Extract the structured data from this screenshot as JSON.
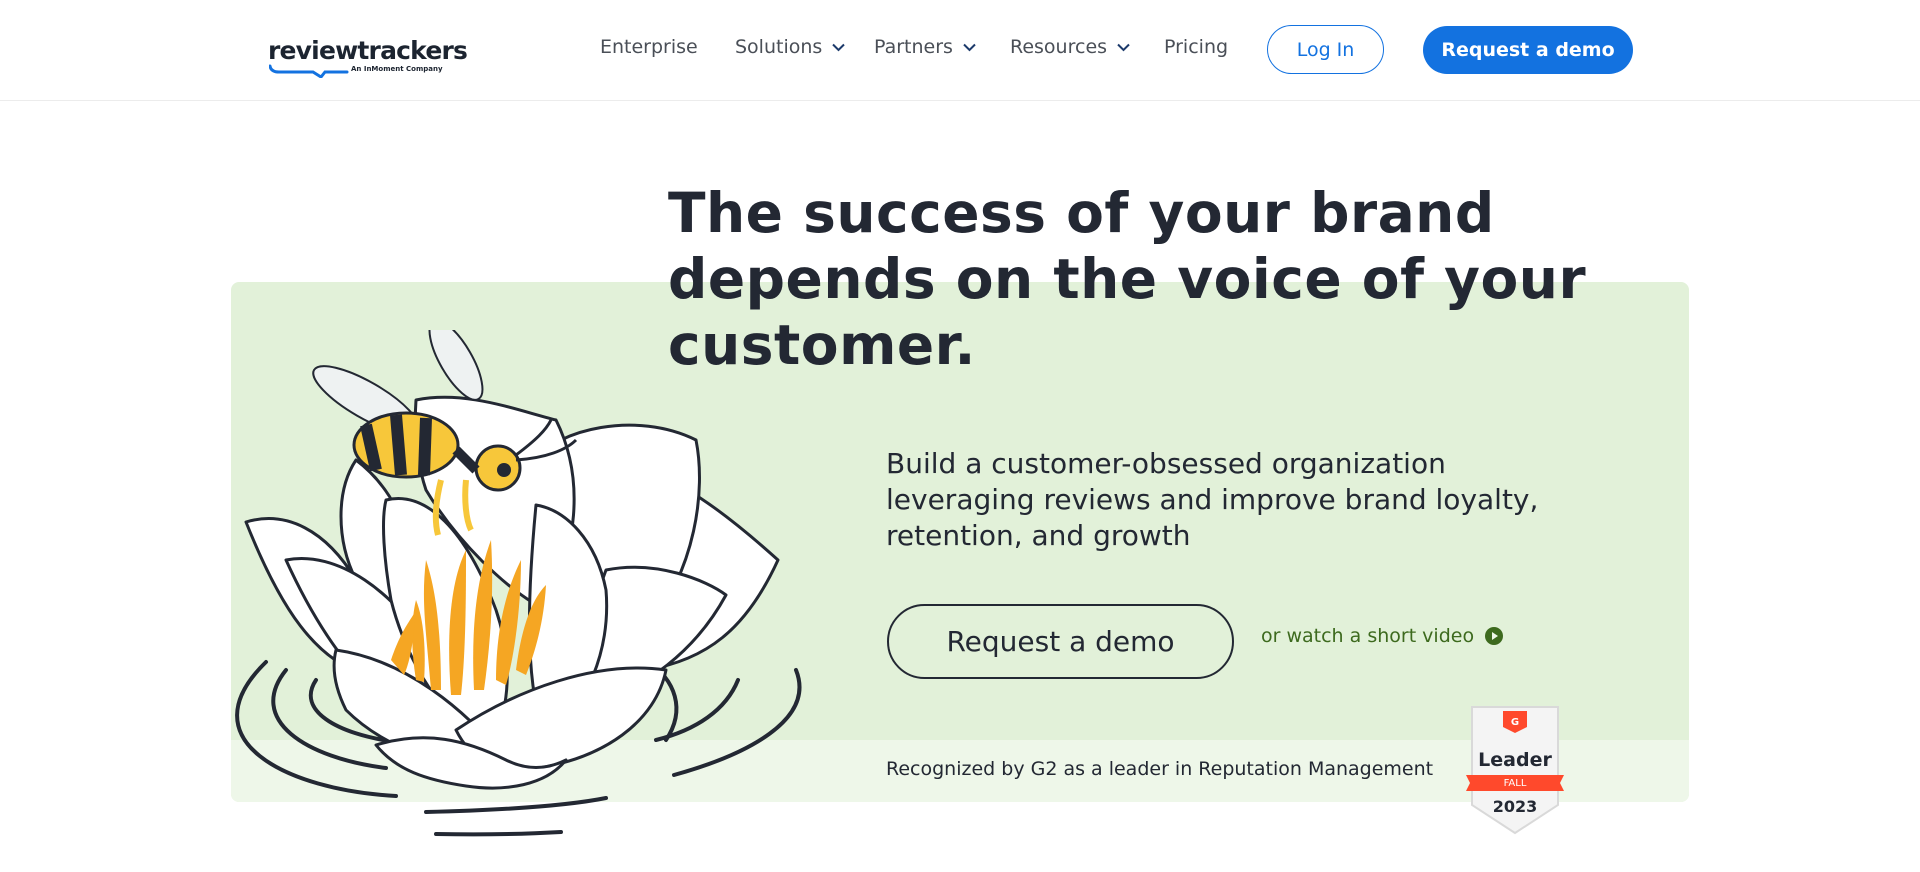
{
  "header": {
    "logo_text": "reviewtrackers",
    "logo_sub": "An InMoment Company",
    "nav": [
      {
        "label": "Enterprise",
        "dropdown": false
      },
      {
        "label": "Solutions",
        "dropdown": true
      },
      {
        "label": "Partners",
        "dropdown": true
      },
      {
        "label": "Resources",
        "dropdown": true
      },
      {
        "label": "Pricing",
        "dropdown": false
      }
    ],
    "login_label": "Log In",
    "demo_label": "Request a demo"
  },
  "hero": {
    "headline": "The success of your brand depends on the voice of your customer.",
    "subcopy": "Build a customer-obsessed organization leveraging reviews and improve brand loyalty, retention, and growth",
    "cta_label": "Request a demo",
    "video_link": "or watch a short video",
    "recognized": "Recognized by G2 as a leader in Reputation Management"
  },
  "badge": {
    "title": "Leader",
    "season": "FALL",
    "year": "2023"
  },
  "colors": {
    "brand_blue": "#1372e0",
    "hero_green": "#e2f1d9",
    "text_dark": "#232833",
    "link_green": "#3d6a1e",
    "g2_red": "#ff492c"
  },
  "icons": {
    "nav_dropdown": "chevron-down-icon",
    "video": "play-circle-icon",
    "badge_logo": "g2-logo-icon"
  }
}
